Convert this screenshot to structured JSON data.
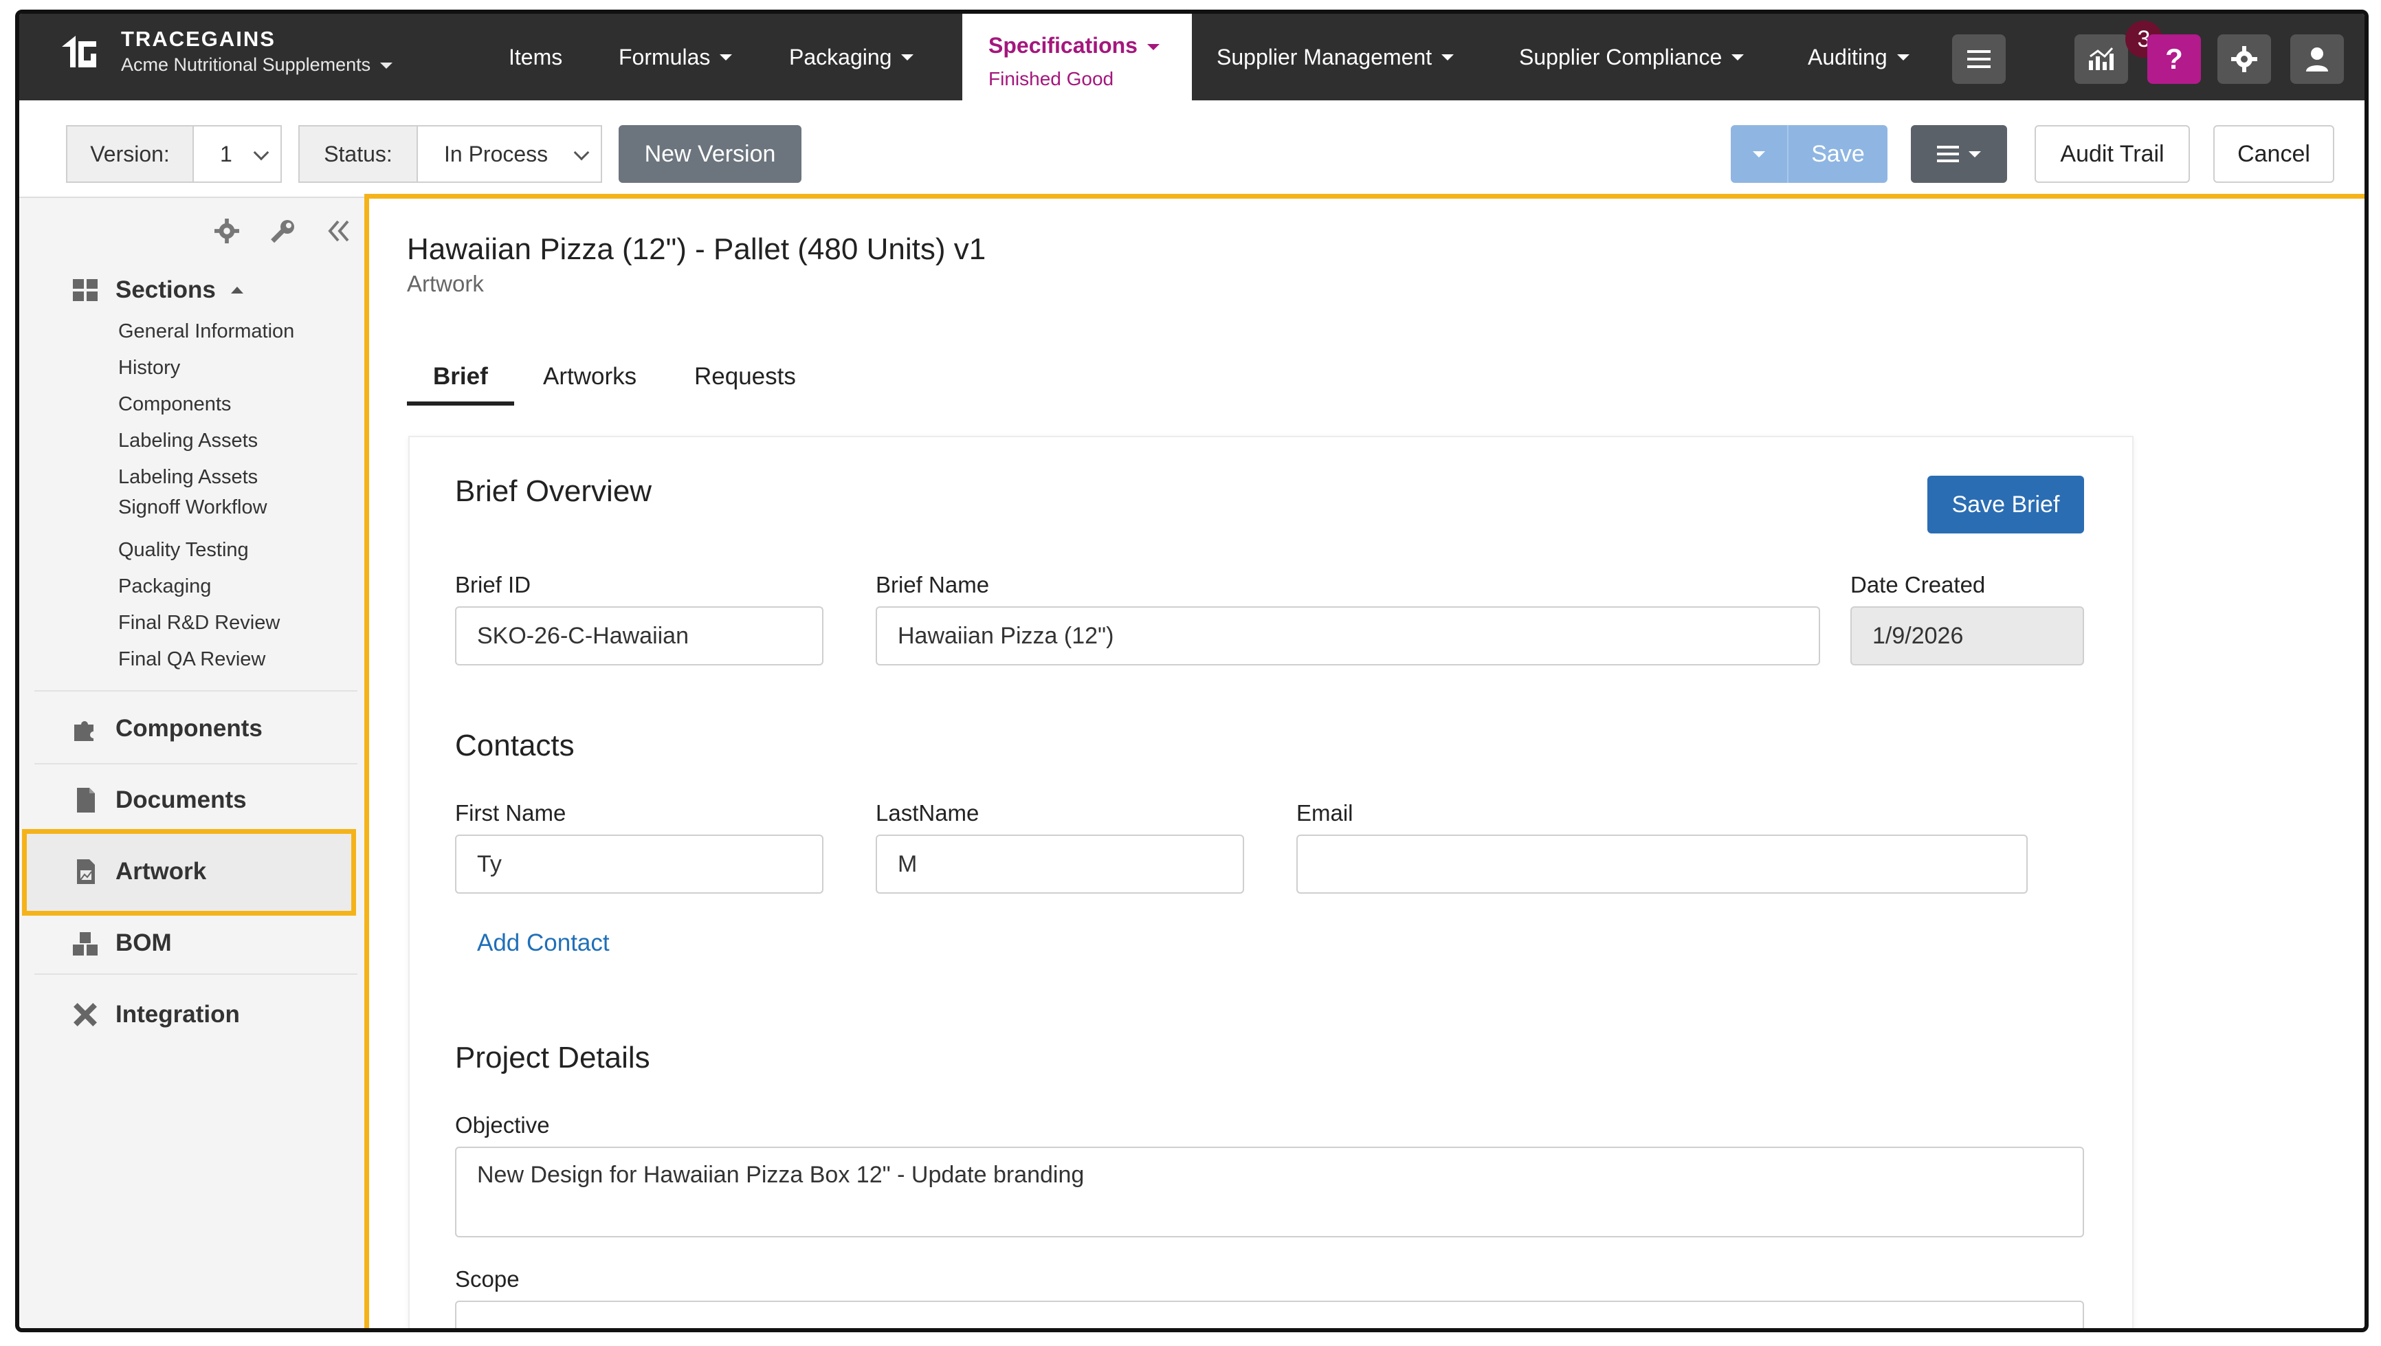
{
  "brand": {
    "name": "TRACEGAINS",
    "org": "Acme Nutritional Supplements"
  },
  "nav": {
    "items": "Items",
    "formulas": "Formulas",
    "packaging": "Packaging",
    "specifications": "Specifications",
    "specifications_sub": "Finished Good",
    "supplier_management": "Supplier Management",
    "supplier_compliance": "Supplier Compliance",
    "auditing": "Auditing",
    "notification_count": "3",
    "help": "?"
  },
  "toolbar": {
    "version_label": "Version:",
    "version_value": "1",
    "status_label": "Status:",
    "status_value": "In Process",
    "new_version": "New Version",
    "save": "Save",
    "audit_trail": "Audit Trail",
    "cancel": "Cancel"
  },
  "sidebar": {
    "sections_label": "Sections",
    "sections": [
      "General Information",
      "History",
      "Components",
      "Labeling Assets",
      "Labeling Assets",
      "Signoff Workflow",
      "Quality Testing",
      "Packaging",
      "Final R&D Review",
      "Final QA Review"
    ],
    "components": "Components",
    "documents": "Documents",
    "artwork": "Artwork",
    "bom": "BOM",
    "integration": "Integration"
  },
  "page": {
    "title": "Hawaiian Pizza (12\") - Pallet (480 Units) v1",
    "subtitle": "Artwork",
    "tabs": [
      "Brief",
      "Artworks",
      "Requests"
    ]
  },
  "brief": {
    "overview_title": "Brief Overview",
    "save_brief": "Save Brief",
    "brief_id_label": "Brief ID",
    "brief_id": "SKO-26-C-Hawaiian",
    "brief_name_label": "Brief Name",
    "brief_name": "Hawaiian Pizza (12\")",
    "date_created_label": "Date Created",
    "date_created": "1/9/2026",
    "contacts_title": "Contacts",
    "first_name_label": "First Name",
    "first_name": "Ty",
    "last_name_label": "LastName",
    "last_name": "M",
    "email_label": "Email",
    "email": "",
    "add_contact": "Add Contact",
    "project_title": "Project Details",
    "objective_label": "Objective",
    "objective": "New Design for Hawaiian Pizza Box 12\" - Update branding",
    "scope_label": "Scope"
  },
  "colors": {
    "nav_bg": "#2f2f2f",
    "accent_magenta": "#a4177d",
    "highlight": "#f5b31a",
    "primary": "#2a6db3"
  }
}
